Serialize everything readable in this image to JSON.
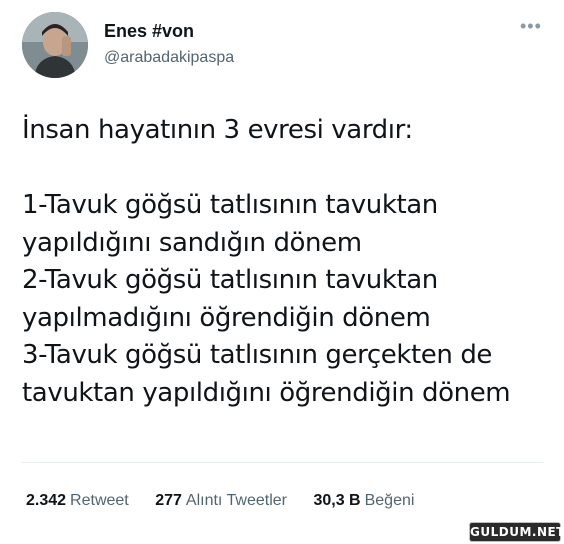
{
  "author": {
    "name": "Enes #von",
    "handle": "@arabadakipaspa",
    "more_icon": "more-horizontal-icon"
  },
  "tweet": {
    "text": "İnsan hayatının 3 evresi vardır:\n\n1-Tavuk göğsü tatlısının tavuktan yapıldığını sandığın dönem\n2-Tavuk göğsü tatlısının tavuktan yapılmadığını öğrendiğin dönem\n3-Tavuk göğsü tatlısının gerçekten de tavuktan yapıldığını öğrendiğin dönem"
  },
  "stats": {
    "retweets_count": "2.342",
    "retweets_label": "Retweet",
    "quotes_count": "277",
    "quotes_label": "Alıntı Tweetler",
    "likes_count": "30,3 B",
    "likes_label": "Beğeni"
  },
  "watermark": {
    "text": "GULDUM.NET"
  }
}
